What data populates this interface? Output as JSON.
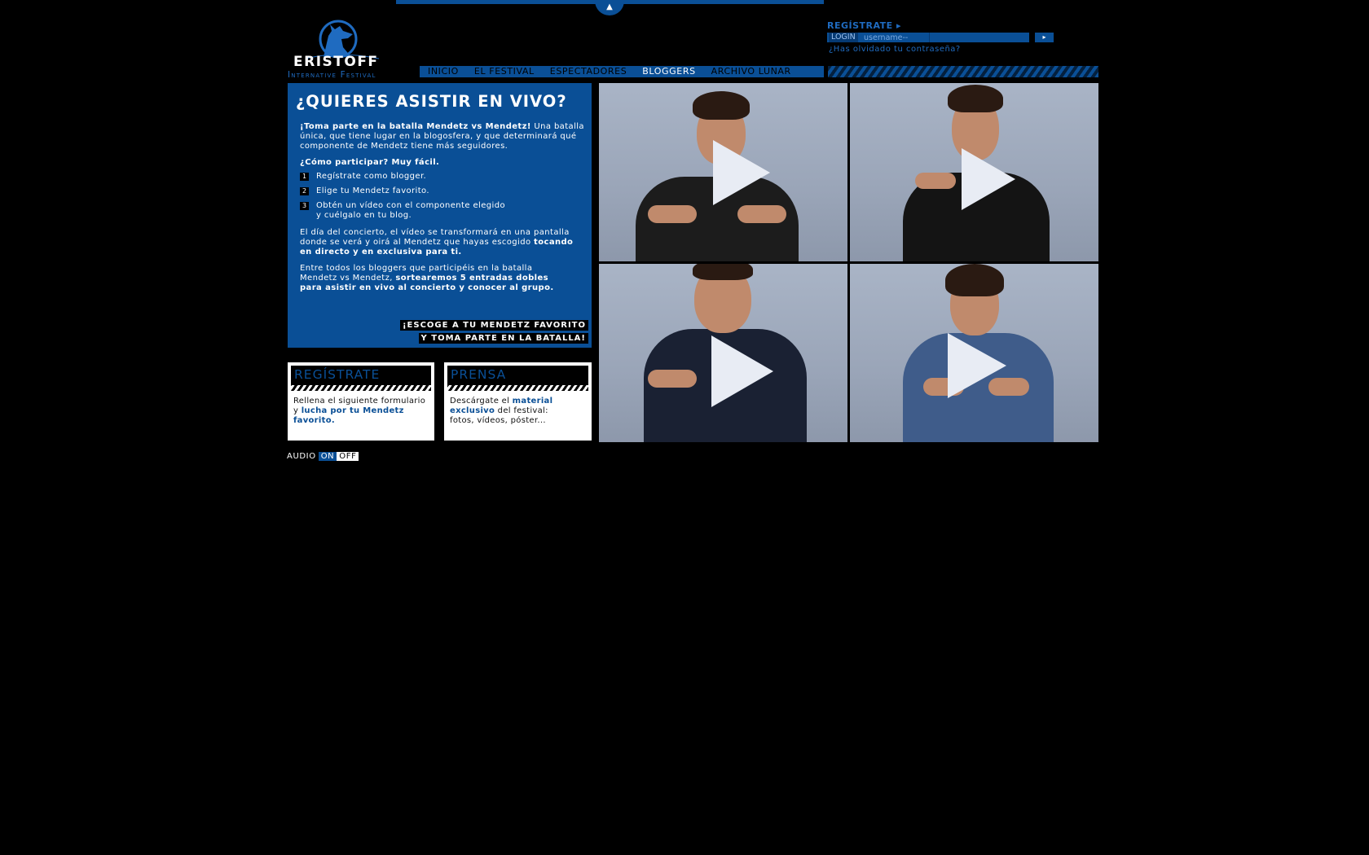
{
  "header": {
    "top_tab_icon": "▲",
    "logo_word": "ERISTOFF",
    "logo_sub": "Internative Festival",
    "logo_icon": "wolf-howling-moon"
  },
  "login": {
    "register_label": "REGÍSTRATE ▸",
    "login_label": "LOGIN",
    "username_value": "username--",
    "submit_icon": "▸",
    "forgot_label": "¿Has olvidado tu contraseña?"
  },
  "nav": {
    "items": [
      "INICIO",
      "EL FESTIVAL",
      "ESPECTADORES",
      "BLOGGERS",
      "ARCHIVO LUNAR"
    ],
    "active": "BLOGGERS"
  },
  "panel": {
    "title": "¿QUIERES ASISTIR EN VIVO?",
    "intro_bold": "¡Toma parte en la batalla Mendetz vs Mendetz!",
    "intro_rest": " Una batalla única, que tiene lugar en la blogosfera, y que determinará qué componente de Mendetz tiene más seguidores.",
    "how": "¿Cómo participar? Muy fácil.",
    "steps": [
      {
        "num": "1",
        "text": "Regístrate como blogger."
      },
      {
        "num": "2",
        "text": "Elige tu Mendetz favorito."
      },
      {
        "num": "3",
        "text": "Obtén un vídeo con el componente elegido",
        "text2": "y cuélgalo en tu blog."
      }
    ],
    "para1_rest": "El día del concierto, el vídeo se transformará en una pantalla donde se verá y oirá al Mendetz que hayas escogido ",
    "para1_bold": "tocando en directo y en exclusiva para ti.",
    "para2_rest": "Entre todos los bloggers que participéis en la batalla Mendetz vs Mendetz, ",
    "para2_bold": "sortearemos 5 entradas dobles para asistir en vivo al concierto y conocer al grupo.",
    "cta_line1": "¡ESCOGE A TU MENDETZ FAVORITO",
    "cta_line2": "Y TOMA PARTE EN LA BATALLA!"
  },
  "boxes": {
    "register": {
      "title": "REGÍSTRATE",
      "text1": "Rellena el siguiente formulario y ",
      "text_hl": "lucha por tu Mendetz favorito.",
      "text2": ""
    },
    "press": {
      "title": "PRENSA",
      "text1": "Descárgate el ",
      "text_hl": "material exclusivo",
      "text2": " del festival: fotos, vídeos, póster..."
    }
  },
  "videos": [
    {
      "name": "video-1",
      "shirt": "#1c1c1c"
    },
    {
      "name": "video-2",
      "shirt": "#141414"
    },
    {
      "name": "video-3",
      "shirt": "#1a2133"
    },
    {
      "name": "video-4",
      "shirt": "#3f5c8a"
    }
  ],
  "audio": {
    "label": "AUDIO",
    "on": "ON",
    "off": "OFF"
  },
  "colors": {
    "brand_blue": "#0a4f96",
    "background": "#000000"
  }
}
